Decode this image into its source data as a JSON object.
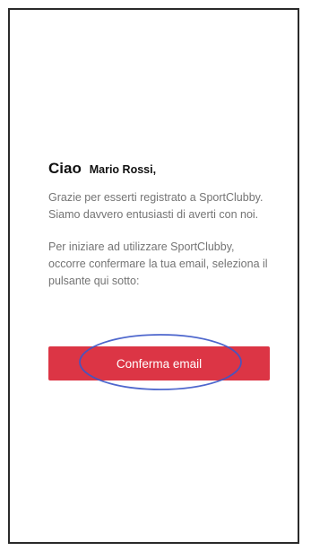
{
  "email": {
    "greeting_word": "Ciao",
    "greeting_name": "Mario Rossi,",
    "paragraph_1": "Grazie per esserti registrato a SportClubby. Siamo davvero entusiasti di averti con noi.",
    "paragraph_2": "Per iniziare ad utilizzare SportClubby, occorre confermare la tua email, seleziona il pulsante qui sotto:",
    "confirm_button_label": "Conferma email"
  },
  "colors": {
    "button_background": "#dc3545",
    "annotation_ellipse": "#3b57c8"
  }
}
